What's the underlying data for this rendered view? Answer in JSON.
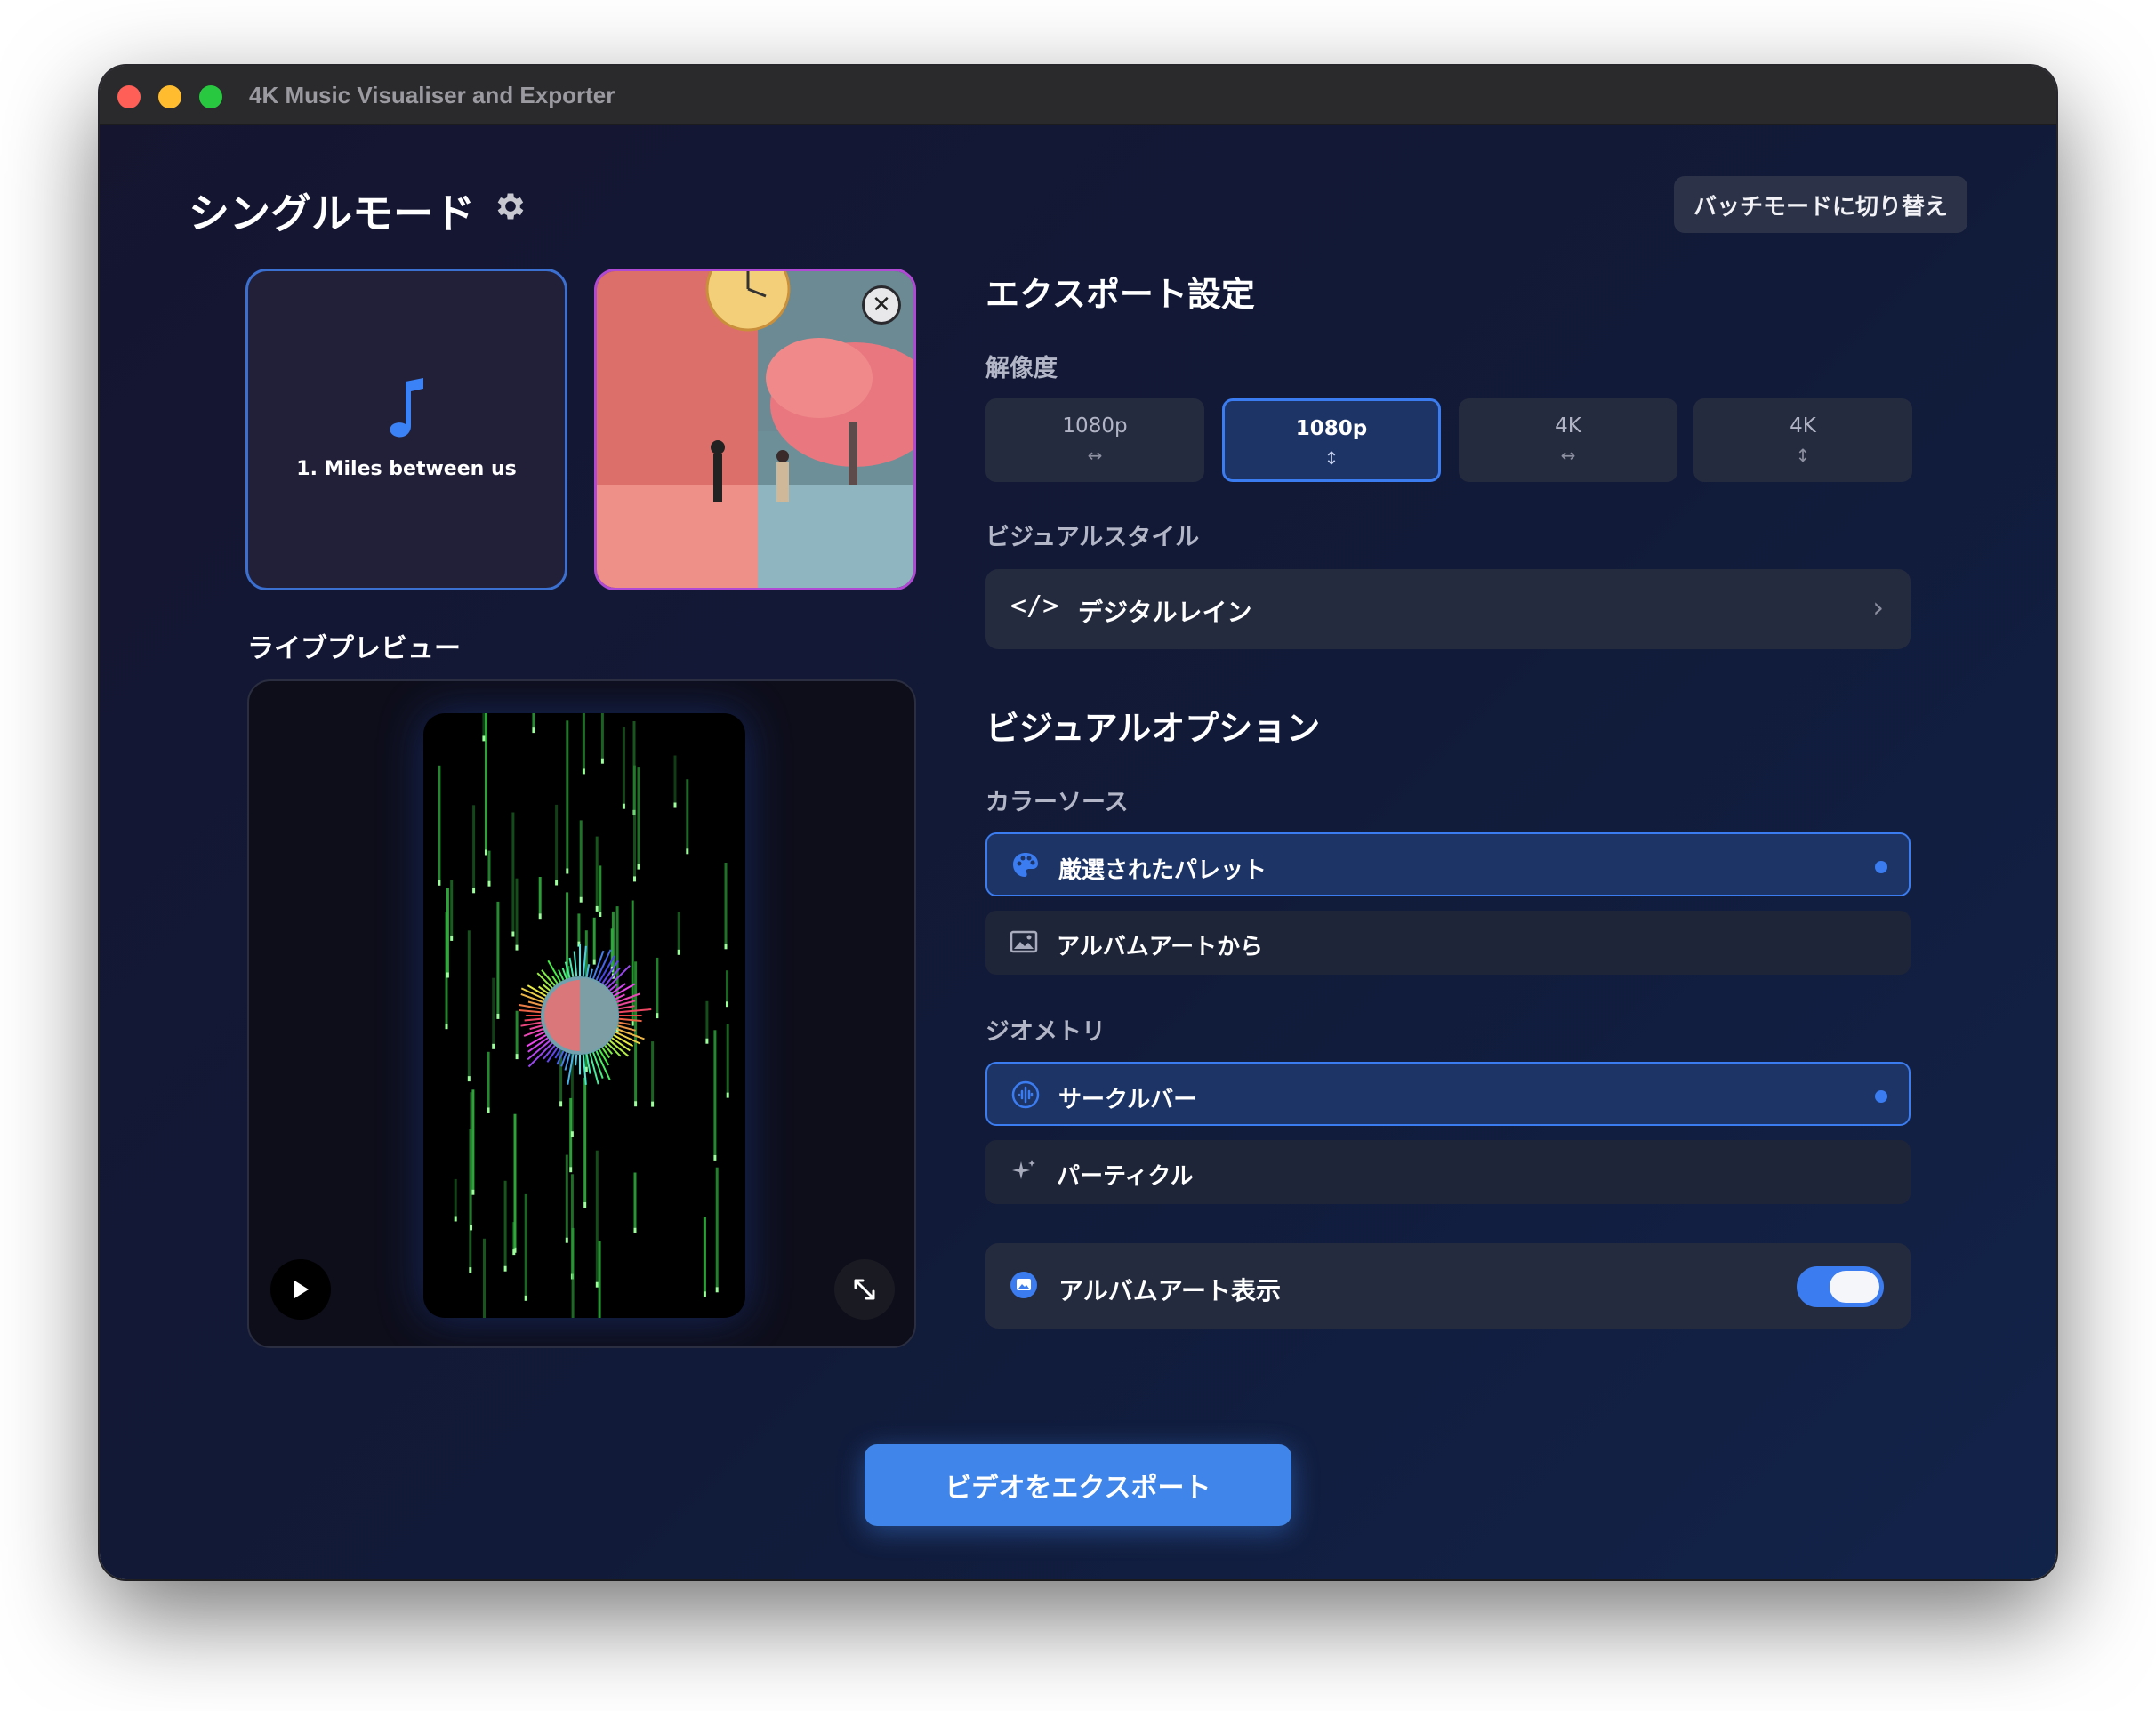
{
  "window": {
    "title": "4K Music Visualiser and Exporter"
  },
  "header": {
    "mode_title": "シングルモード",
    "batch_button": "バッチモードに切り替え"
  },
  "track": {
    "name": "1. Miles between us",
    "icon": "music-note-icon"
  },
  "album_art": {
    "close_icon": "close-icon"
  },
  "preview": {
    "label": "ライブプレビュー",
    "style": "デジタルレイン"
  },
  "export_settings": {
    "title": "エクスポート設定",
    "resolution_label": "解像度",
    "resolutions": [
      {
        "label": "1080p",
        "arrow": "↔",
        "selected": false
      },
      {
        "label": "1080p",
        "arrow": "↕",
        "selected": true
      },
      {
        "label": "4K",
        "arrow": "↔",
        "selected": false
      },
      {
        "label": "4K",
        "arrow": "↕",
        "selected": false
      }
    ],
    "visual_style_label": "ビジュアルスタイル",
    "visual_style": {
      "icon": "</>",
      "value": "デジタルレイン",
      "chevron": "›"
    }
  },
  "visual_options": {
    "title": "ビジュアルオプション",
    "color_source_label": "カラーソース",
    "color_sources": [
      {
        "label": "厳選されたパレット",
        "icon": "palette-icon",
        "selected": true
      },
      {
        "label": "アルバムアートから",
        "icon": "image-icon",
        "selected": false
      }
    ],
    "geometry_label": "ジオメトリ",
    "geometries": [
      {
        "label": "サークルバー",
        "icon": "waveform-icon",
        "selected": true
      },
      {
        "label": "パーティクル",
        "icon": "sparkle-icon",
        "selected": false
      }
    ],
    "album_art_toggle": {
      "label": "アルバムアート表示",
      "on": true
    }
  },
  "export_button": "ビデオをエクスポート",
  "colors": {
    "accent": "#3b7cf0",
    "background": "#131a36",
    "panel": "#252b3e"
  }
}
